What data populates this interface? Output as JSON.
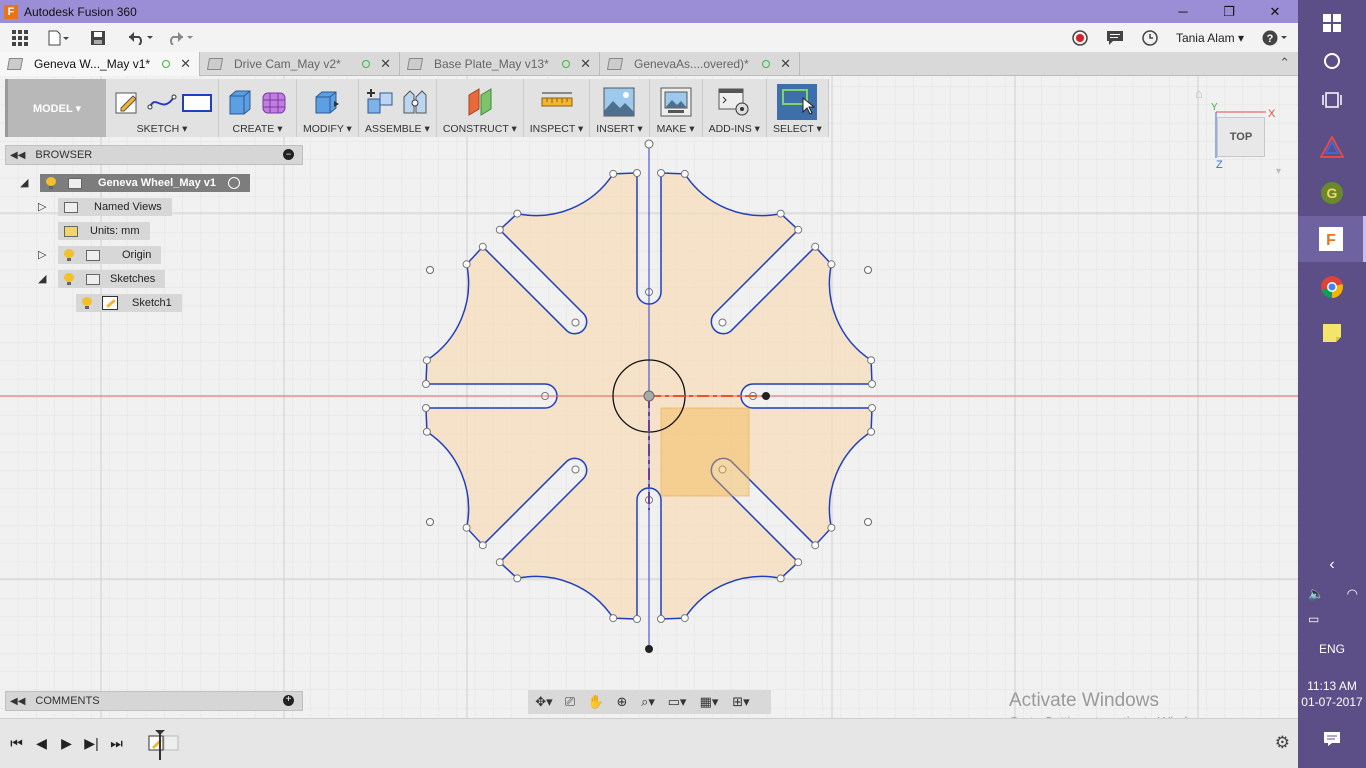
{
  "titlebar": {
    "title": "Autodesk Fusion 360",
    "minimize": "─",
    "maximize": "❐",
    "close": "✕"
  },
  "apptoolbar": {
    "user": "Tania Alam ▾"
  },
  "tabs": [
    {
      "label": "Geneva W..._May v1*",
      "active": true
    },
    {
      "label": "Drive Cam_May v2*",
      "active": false
    },
    {
      "label": "Base Plate_May v13*",
      "active": false
    },
    {
      "label": "GenevaAs....overed)*",
      "active": false
    }
  ],
  "ribbon": {
    "mode": "MODEL ▾",
    "groups": [
      "SKETCH ▾",
      "CREATE ▾",
      "MODIFY ▾",
      "ASSEMBLE ▾",
      "CONSTRUCT ▾",
      "INSPECT ▾",
      "INSERT ▾",
      "MAKE ▾",
      "ADD-INS ▾",
      "SELECT ▾"
    ]
  },
  "browser": {
    "title": "BROWSER",
    "root": "Geneva Wheel_May v1",
    "items": {
      "named_views": "Named Views",
      "units": "Units: mm",
      "origin": "Origin",
      "sketches": "Sketches",
      "sketch1": "Sketch1"
    }
  },
  "comments": {
    "title": "COMMENTS"
  },
  "viewcube": {
    "face": "TOP",
    "axis_x": "X",
    "axis_y": "Y",
    "axis_z": "Z"
  },
  "watermark": {
    "line1": "Activate Windows",
    "line2": "Go to Settings to activate Windows."
  },
  "taskbar": {
    "language": "ENG",
    "time": "11:13 AM",
    "date": "01-07-2017"
  },
  "colors": {
    "accent_title": "#9b8ed6",
    "sketch_line": "#1f3fbf",
    "profile_fill": "#f5dcb9",
    "taskbar": "#5c4e86"
  }
}
